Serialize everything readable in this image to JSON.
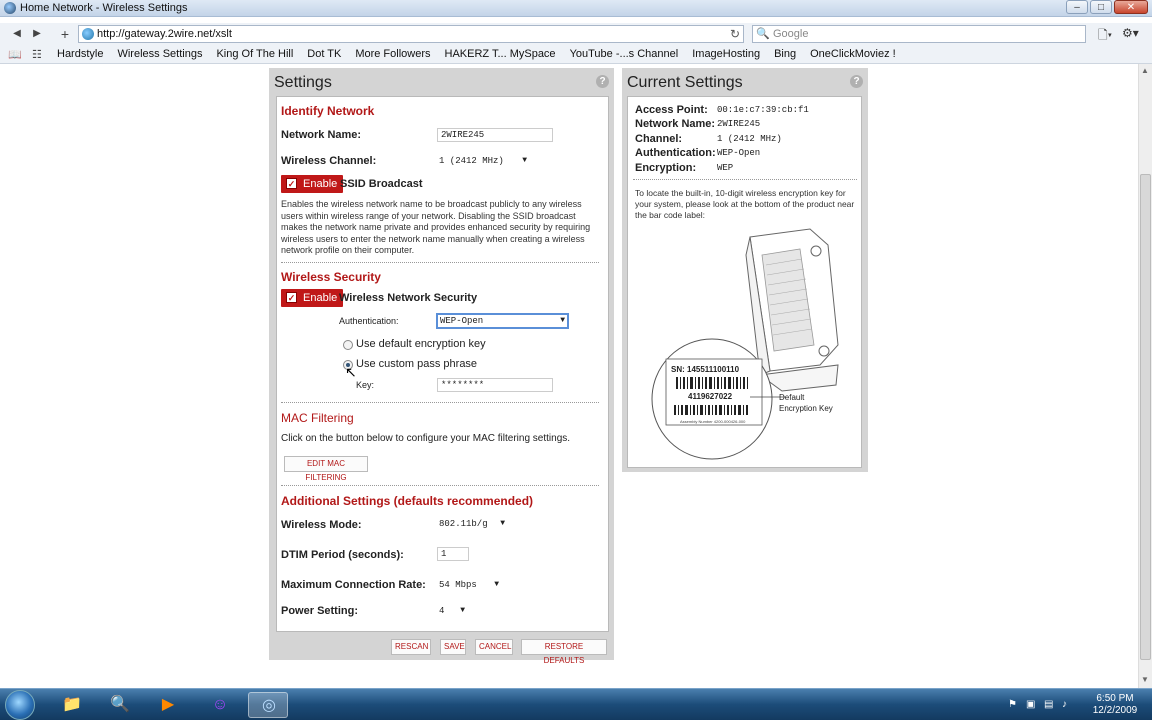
{
  "window": {
    "title": "Home Network - Wireless Settings",
    "min": "–",
    "max": "□",
    "close": "✕"
  },
  "nav": {
    "back": "◀",
    "forward": "▶",
    "add": "+",
    "url": "http://gateway.2wire.net/xslt",
    "reload": "↻",
    "search_placeholder": "Google",
    "page_icon": "🗋▾",
    "tools_icon": "⚙▾"
  },
  "bookmarks": [
    "Hardstyle",
    "Wireless Settings",
    "King Of The Hill",
    "Dot TK",
    "More Followers",
    "HAKERZ T... MySpace",
    "YouTube -...s Channel",
    "ImageHosting",
    "Bing",
    "OneClickMoviez !"
  ],
  "settings": {
    "title": "Settings",
    "help": "?",
    "identify": {
      "heading": "Identify Network",
      "network_name_label": "Network Name:",
      "network_name_value": "2WIRE245",
      "channel_label": "Wireless Channel:",
      "channel_value": "1 (2412 MHz)",
      "enable_label": "Enable",
      "ssid_label": "SSID Broadcast",
      "ssid_desc": "Enables the wireless network name to be broadcast publicly to any wireless users within wireless range of your network. Disabling the SSID broadcast makes the network name private and provides enhanced security by requiring wireless users to enter the network name manually when creating a wireless network profile on their computer."
    },
    "security": {
      "heading": "Wireless Security",
      "enable_label": "Enable",
      "wns_label": "Wireless Network Security",
      "auth_label": "Authentication:",
      "auth_value": "WEP-Open",
      "radio_default": "Use default encryption key",
      "radio_custom": "Use custom pass phrase",
      "key_label": "Key:",
      "key_value": "********"
    },
    "mac": {
      "heading": "MAC Filtering",
      "desc": "Click on the button below to configure your MAC filtering settings.",
      "button": "EDIT MAC FILTERING"
    },
    "additional": {
      "heading": "Additional Settings (defaults recommended)",
      "mode_label": "Wireless Mode:",
      "mode_value": "802.11b/g",
      "dtim_label": "DTIM Period (seconds):",
      "dtim_value": "1",
      "rate_label": "Maximum Connection Rate:",
      "rate_value": "54 Mbps",
      "power_label": "Power Setting:",
      "power_value": "4"
    },
    "buttons": {
      "rescan": "RESCAN",
      "save": "SAVE",
      "cancel": "CANCEL",
      "restore": "RESTORE DEFAULTS"
    }
  },
  "current": {
    "title": "Current Settings",
    "help": "?",
    "ap_label": "Access Point:",
    "ap_value": "00:1e:c7:39:cb:f1",
    "name_label": "Network Name:",
    "name_value": "2WIRE245",
    "channel_label": "Channel:",
    "channel_value": "1 (2412 MHz)",
    "auth_label": "Authentication:",
    "auth_value": "WEP-Open",
    "enc_label": "Encryption:",
    "enc_value": "WEP",
    "note": "To locate the built-in, 10-digit wireless encryption key for your system, please look at the bottom of the product near the bar code label:",
    "label_sn": "SN: 145511100110",
    "label_key": "4119627022",
    "label_assembly": "Assembly Number 4200-000426-000",
    "callout": "Default Encryption Key"
  },
  "taskbar": {
    "time": "6:50 PM",
    "date": "12/2/2009"
  },
  "colors": {
    "accent_red": "#b21818",
    "enable_red": "#c01818",
    "panel_gray": "#d4d4d4"
  }
}
